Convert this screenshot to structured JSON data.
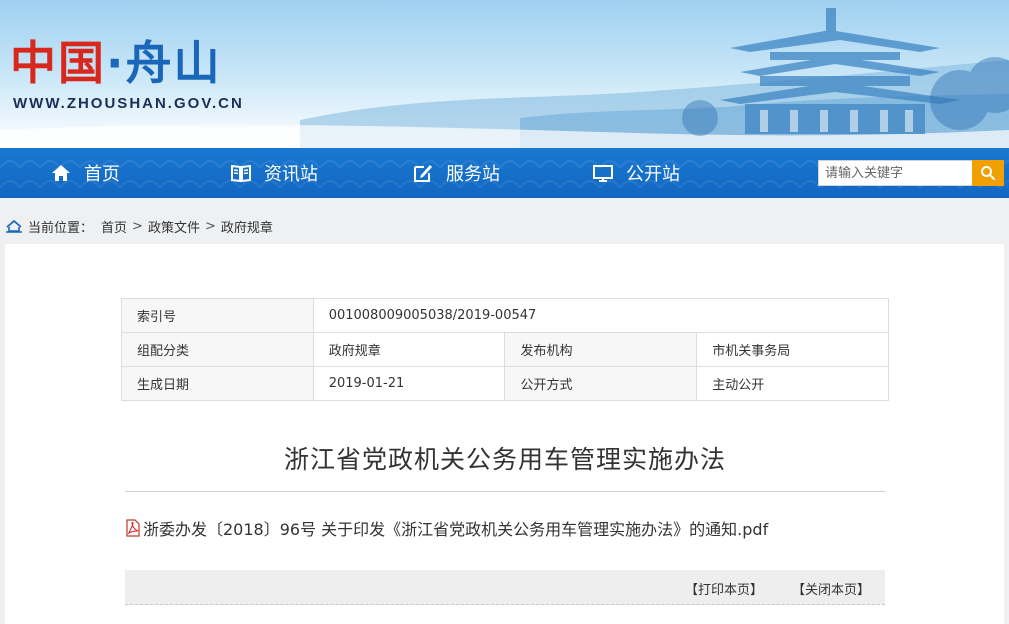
{
  "header": {
    "logo_left": "中国",
    "logo_dot": "·",
    "logo_right": "舟山",
    "logo_en": "WWW.ZHOUSHAN.GOV.CN"
  },
  "nav": {
    "items": [
      {
        "label": "首页",
        "icon": "home-icon"
      },
      {
        "label": "资讯站",
        "icon": "book-icon"
      },
      {
        "label": "服务站",
        "icon": "edit-icon"
      },
      {
        "label": "公开站",
        "icon": "monitor-icon"
      }
    ],
    "search_placeholder": "请输入关键字"
  },
  "breadcrumb": {
    "label": "当前位置：",
    "items": [
      "首页",
      "政策文件",
      "政府规章"
    ],
    "separator": ">"
  },
  "meta": {
    "index_label": "索引号",
    "index_value": "001008009005038/2019-00547",
    "category_label": "组配分类",
    "category_value": "政府规章",
    "publisher_label": "发布机构",
    "publisher_value": "市机关事务局",
    "date_label": "生成日期",
    "date_value": "2019-01-21",
    "open_label": "公开方式",
    "open_value": "主动公开"
  },
  "article": {
    "title": "浙江省党政机关公务用车管理实施办法",
    "attachment": "浙委办发〔2018〕96号 关于印发《浙江省党政机关公务用车管理实施办法》的通知.pdf"
  },
  "actions": {
    "print": "【打印本页】",
    "close": "【关闭本页】"
  },
  "colors": {
    "nav_blue": "#1167c2",
    "logo_red": "#d8281e",
    "logo_blue": "#1a66b8",
    "search_btn": "#f0a000"
  }
}
